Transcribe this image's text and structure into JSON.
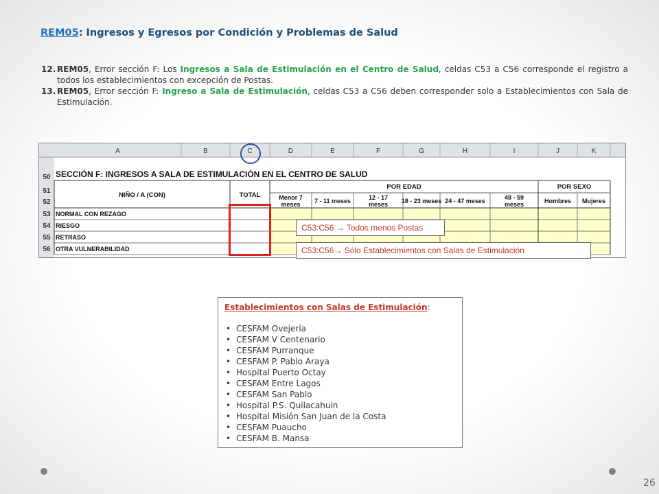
{
  "title": {
    "code": "REM05",
    "rest": ": Ingresos y Egresos por Condición y Problemas de Salud"
  },
  "notes": [
    {
      "num": "12.",
      "lead": "REM05",
      "text_a": ", Error sección F: Los ",
      "highlight": "Ingresos a Sala de Estimulación en el Centro de Salud",
      "text_b": ", celdas C53 a C56 corresponde el registro a todos los establecimientos  con excepción de Postas."
    },
    {
      "num": "13.",
      "lead": "REM05",
      "text_a": ", Error sección F: ",
      "highlight": "Ingreso a Sala de Estimulación",
      "text_b": ", celdas C53 a C56 deben corresponder solo a Establecimientos con Sala de Estimulación."
    }
  ],
  "sheet": {
    "col_headers": [
      "A",
      "B",
      "C",
      "D",
      "E",
      "F",
      "G",
      "H",
      "I",
      "J",
      "K"
    ],
    "row_numbers": [
      "50",
      "51",
      "52",
      "53",
      "54",
      "55",
      "56"
    ],
    "section_title": "SECCIÓN F:  INGRESOS A SALA DE ESTIMULACIÓN EN EL CENTRO DE SALUD",
    "header_nino": "NIÑO / A (CON)",
    "header_total": "TOTAL",
    "header_edad": "POR EDAD",
    "header_sexo": "POR SEXO",
    "age_cols": [
      "Menor 7|meses",
      "7 - 11 meses",
      "12 - 17|meses",
      "18 - 23 meses",
      "24 - 47 meses",
      "48 - 59|meses"
    ],
    "sex_cols": [
      "Hombres",
      "Mujeres"
    ],
    "rows": [
      "NORMAL CON REZAGO",
      "RIESGO",
      "RETRASO",
      "OTRA VULNERABILIDAD"
    ]
  },
  "callouts": {
    "one": "C53:C56 → Todos menos Postas",
    "two": "C53:C56→ Sólo Establecimientos con Salas de Estimulación"
  },
  "establishments": {
    "heading": "Establecimientos con Salas de Estimulación",
    "heading_suffix": ":",
    "items": [
      "CESFAM Ovejería",
      "CESFAM V Centenario",
      "CESFAM Purranque",
      "CESFAM P. Pablo Araya",
      "Hospital Puerto Octay",
      "CESFAM Entre Lagos",
      "CESFAM San Pablo",
      "Hospital P.S. Quilacahuin",
      "Hospital Misión San Juan de la Costa",
      "CESFAM Puaucho",
      "CESFAM B. Mansa"
    ]
  },
  "page_number": "26",
  "colors": {
    "title": "#1f4e79",
    "green": "#22a34a",
    "red": "#e02020",
    "blue": "#2a4fa8",
    "cell_fill": "#ffffcc"
  }
}
